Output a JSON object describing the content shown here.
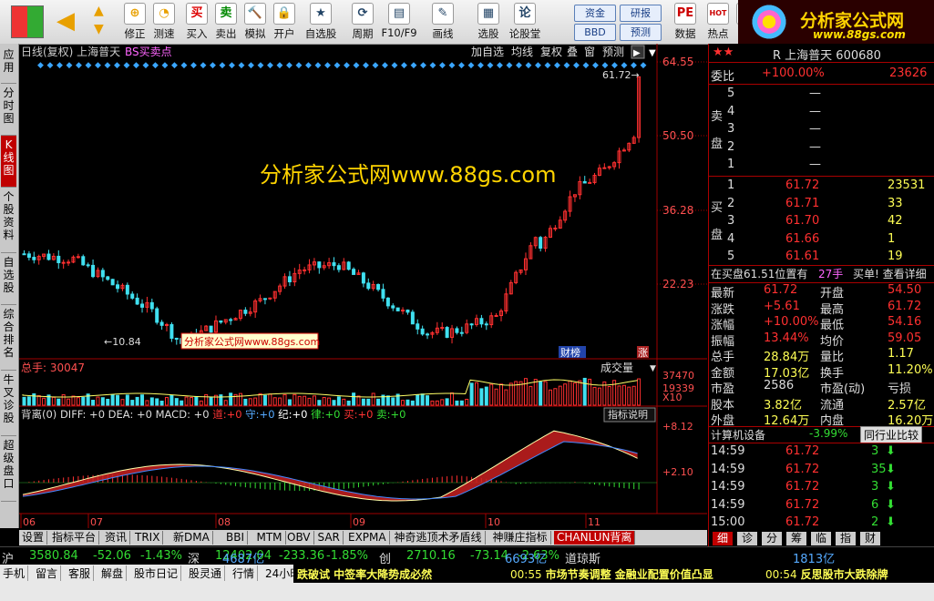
{
  "toolbar": {
    "items": [
      {
        "label": "买入",
        "icon": "买"
      },
      {
        "label": "卖出",
        "icon": "卖"
      },
      {
        "label": "模拟",
        "icon": "🔨"
      },
      {
        "label": "开户",
        "icon": "🔒"
      },
      {
        "label": "自选股",
        "icon": "★"
      },
      {
        "label": "周期",
        "icon": "⟳"
      },
      {
        "label": "F10/F9",
        "icon": "▤"
      },
      {
        "label": "画线",
        "icon": "✎"
      },
      {
        "label": "选股",
        "icon": "▦"
      },
      {
        "label": "论股堂",
        "icon": "论"
      },
      {
        "label": "数据",
        "icon": "PE"
      },
      {
        "label": "热点",
        "icon": "HOT"
      },
      {
        "label": "新",
        "icon": "◆"
      }
    ],
    "nav": [
      {
        "label": "修正",
        "icon": "⊕"
      },
      {
        "label": "测速",
        "icon": "◔"
      }
    ],
    "box_buttons": [
      "资金",
      "研报",
      "BBD",
      "预测"
    ]
  },
  "brand": {
    "title": "分析家公式网",
    "url": "www.88gs.com"
  },
  "left_tabs": [
    {
      "label": "应用",
      "active": false
    },
    {
      "label": "分时图",
      "active": false
    },
    {
      "label": "K线图",
      "active": true
    },
    {
      "label": "个股资料",
      "active": false
    },
    {
      "label": "自选股",
      "active": false
    },
    {
      "label": "综合排名",
      "active": false
    },
    {
      "label": "牛叉诊股",
      "active": false
    },
    {
      "label": "超级盘口",
      "active": false
    }
  ],
  "chart": {
    "header_left": "日线(复权) 上海普天",
    "header_indicator": "BS买卖点",
    "header_buttons": [
      "加自选",
      "均线",
      "复权",
      "叠",
      "窗",
      "预测"
    ],
    "watermark": "分析家公式网www.88gs.com",
    "label_box": "分析家公式网www.88gs.com",
    "low_label": "10.84",
    "high_label": "61.72",
    "price_ticks": [
      "64.55",
      "50.50",
      "36.28",
      "22.23"
    ],
    "badges": {
      "cai": "财",
      "jiang": "榜",
      "zhang": "涨"
    },
    "volume_title": "总手: 30047",
    "volume_dropdown": "成交量",
    "volume_ticks": [
      "37470",
      "19339",
      "X10"
    ],
    "macd_title": "背离(0) DIFF: +0 DEA: +0 MACD: +0",
    "macd_signals": [
      {
        "label": "道:",
        "value": "+0",
        "color": "#ff3333"
      },
      {
        "label": "守:",
        "value": "+0",
        "color": "#55aaff"
      },
      {
        "label": "纪:",
        "value": "+0",
        "color": "#ffffff"
      },
      {
        "label": "律:",
        "value": "+0",
        "color": "#33dd33"
      },
      {
        "label": "买:",
        "value": "+0",
        "color": "#ff3333"
      },
      {
        "label": "卖:",
        "value": "+0",
        "color": "#33dd33"
      }
    ],
    "macd_help": "指标说明",
    "macd_ticks": [
      "+8.12",
      "+2.10"
    ],
    "months": [
      "06",
      "07",
      "08",
      "09",
      "10",
      "11"
    ],
    "colors": {
      "up": "#ff3030",
      "down": "#40e0f0",
      "axis": "#a00000",
      "text": "#ff5050"
    }
  },
  "bottom_tabs": [
    {
      "label": "设置",
      "active": false
    },
    {
      "label": "指标平台",
      "active": false
    },
    {
      "label": "资讯",
      "active": false
    },
    {
      "label": "TRIX",
      "active": false
    },
    {
      "label": "新DMA",
      "active": false
    },
    {
      "label": "BBI",
      "active": false
    },
    {
      "label": "MTM",
      "active": false
    },
    {
      "label": "OBV",
      "active": false
    },
    {
      "label": "SAR",
      "active": false
    },
    {
      "label": "EXPMA",
      "active": false
    },
    {
      "label": "神奇逃顶术矛盾线",
      "active": false
    },
    {
      "label": "神赚庄指标",
      "active": false
    },
    {
      "label": "CHANLUN背离",
      "active": true
    }
  ],
  "quote": {
    "title": "R 上海普天 600680",
    "weibi_label": "委比",
    "weibi_value": "+100.00%",
    "weicha_value": "23626",
    "sell_label": "卖盘",
    "buy_label": "买盘",
    "sell": [
      {
        "level": "5",
        "price": "—",
        "vol": ""
      },
      {
        "level": "4",
        "price": "—",
        "vol": ""
      },
      {
        "level": "3",
        "price": "—",
        "vol": ""
      },
      {
        "level": "2",
        "price": "—",
        "vol": ""
      },
      {
        "level": "1",
        "price": "—",
        "vol": ""
      }
    ],
    "buy": [
      {
        "level": "1",
        "price": "61.72",
        "vol": "23531"
      },
      {
        "level": "2",
        "price": "61.71",
        "vol": "33"
      },
      {
        "level": "3",
        "price": "61.70",
        "vol": "42"
      },
      {
        "level": "4",
        "price": "61.66",
        "vol": "1"
      },
      {
        "level": "5",
        "price": "61.61",
        "vol": "19"
      }
    ],
    "info_line": "在买盘61.51位置有",
    "info_hands": "27手",
    "info_tail": "买单! 查看详细",
    "stats": [
      {
        "k1": "最新",
        "v1": "61.72",
        "k2": "开盘",
        "v2": "54.50"
      },
      {
        "k1": "涨跌",
        "v1": "+5.61",
        "k2": "最高",
        "v2": "61.72"
      },
      {
        "k1": "涨幅",
        "v1": "+10.00%",
        "k2": "最低",
        "v2": "54.16"
      },
      {
        "k1": "振幅",
        "v1": "13.44%",
        "k2": "均价",
        "v2": "59.05"
      },
      {
        "k1": "总手",
        "v1": "28.84万",
        "k2": "量比",
        "v2": "1.17"
      },
      {
        "k1": "金额",
        "v1": "17.03亿",
        "k2": "换手",
        "v2": "11.20%"
      },
      {
        "k1": "市盈",
        "v1": "2586",
        "k2": "市盈(动)",
        "v2": "亏损"
      },
      {
        "k1": "股本",
        "v1": "3.82亿",
        "k2": "流通",
        "v2": "2.57亿"
      },
      {
        "k1": "外盘",
        "v1": "12.64万",
        "k2": "内盘",
        "v2": "16.20万"
      }
    ],
    "sector_name": "计算机设备",
    "sector_change": "-3.99%",
    "sector_button": "同行业比较",
    "ticks": [
      {
        "time": "14:59",
        "price": "61.72",
        "vol": "3"
      },
      {
        "time": "14:59",
        "price": "61.72",
        "vol": "35"
      },
      {
        "time": "14:59",
        "price": "61.72",
        "vol": "3"
      },
      {
        "time": "14:59",
        "price": "61.72",
        "vol": "6"
      },
      {
        "time": "15:00",
        "price": "61.72",
        "vol": "2"
      }
    ],
    "bottom_tabs": [
      "细",
      "诊",
      "分",
      "筹",
      "临",
      "指",
      "财"
    ]
  },
  "index_bar": [
    {
      "name": "沪",
      "value": "3580.84",
      "change": "-52.06",
      "pct": "-1.43%",
      "amount": "4687亿"
    },
    {
      "name": "深",
      "value": "12402.04",
      "change": "-233.36",
      "pct": "-1.85%",
      "amount": "6693亿"
    },
    {
      "name": "创",
      "value": "2710.16",
      "change": "-73.14",
      "pct": "-2.63%",
      "amount": "1813亿"
    },
    {
      "name": "道琼斯",
      "value": "",
      "change": "",
      "pct": "",
      "amount": ""
    }
  ],
  "status_bar": {
    "items": [
      "手机",
      "留言",
      "客服",
      "解盘",
      "股市日记",
      "股灵通",
      "行情",
      "24小时滚动"
    ],
    "news": [
      {
        "time": "",
        "text": "跌破试 中签率大降势成必然"
      },
      {
        "time": "00:55",
        "text": "市场节奏调整 金融业配置价值凸显"
      },
      {
        "time": "00:54",
        "text": "反思股市大跌除牌"
      }
    ]
  }
}
